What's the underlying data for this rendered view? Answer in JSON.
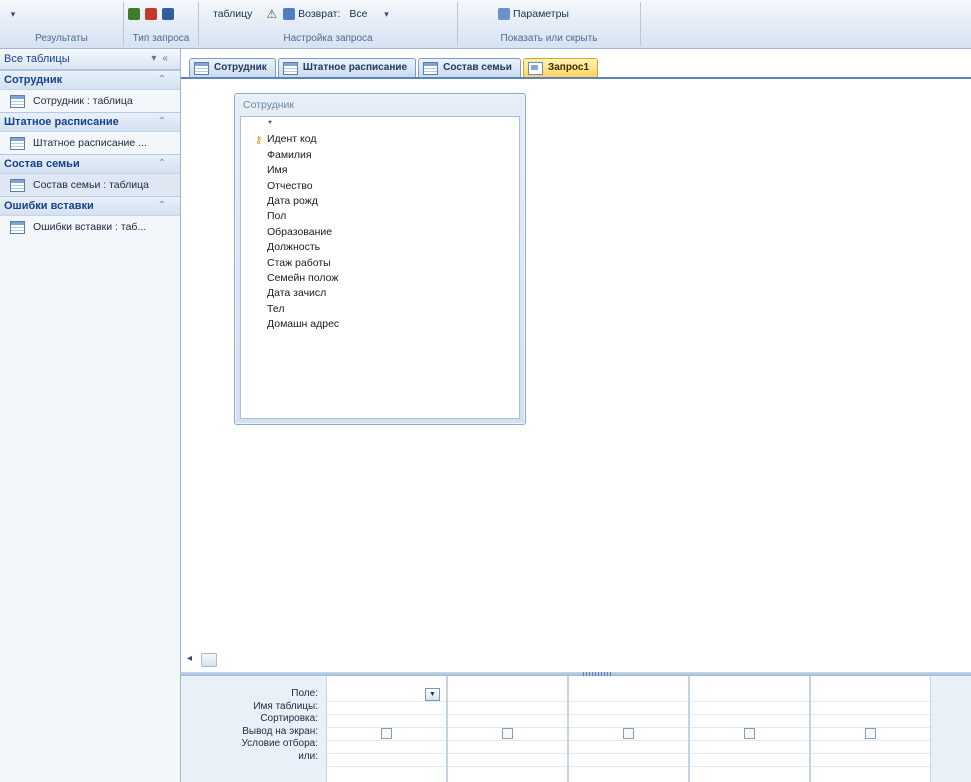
{
  "ribbon": {
    "groups": [
      {
        "label": "Результаты"
      },
      {
        "label": "Тип запроса"
      },
      {
        "label": "Настройка запроса"
      },
      {
        "label": "Показать или скрыть"
      }
    ],
    "table_button": "таблицу",
    "return_label": "Возврат:",
    "return_value": "Все",
    "params_label": "Параметры"
  },
  "nav": {
    "header": "Все таблицы",
    "groups": [
      {
        "title": "Сотрудник",
        "item": "Сотрудник : таблица"
      },
      {
        "title": "Штатное расписание",
        "item": "Штатное расписание ..."
      },
      {
        "title": "Состав семьи",
        "item": "Состав семьи : таблица"
      },
      {
        "title": "Ошибки вставки",
        "item": "Ошибки вставки : таб..."
      }
    ]
  },
  "tabs": [
    {
      "label": "Сотрудник"
    },
    {
      "label": "Штатное расписание"
    },
    {
      "label": "Состав семьи"
    },
    {
      "label": "Запрос1"
    }
  ],
  "field_list": {
    "title": "Сотрудник",
    "fields": [
      "*",
      "Идент код",
      "Фамилия",
      "Имя",
      "Отчество",
      "Дата рожд",
      "Пол",
      "Образование",
      "Должность",
      "Стаж работы",
      "Семейн полож",
      "Дата зачисл",
      "Тел",
      "Домашн адрес"
    ]
  },
  "grid": {
    "row_labels": [
      "Поле:",
      "Имя таблицы:",
      "Сортировка:",
      "Вывод на экран:",
      "Условие отбора:",
      "или:"
    ],
    "column_count": 5
  },
  "colors": {
    "ribbon_bg": "#dfe8f5",
    "tab_active": "#ffd35f",
    "nav_group_text": "#15428b"
  }
}
